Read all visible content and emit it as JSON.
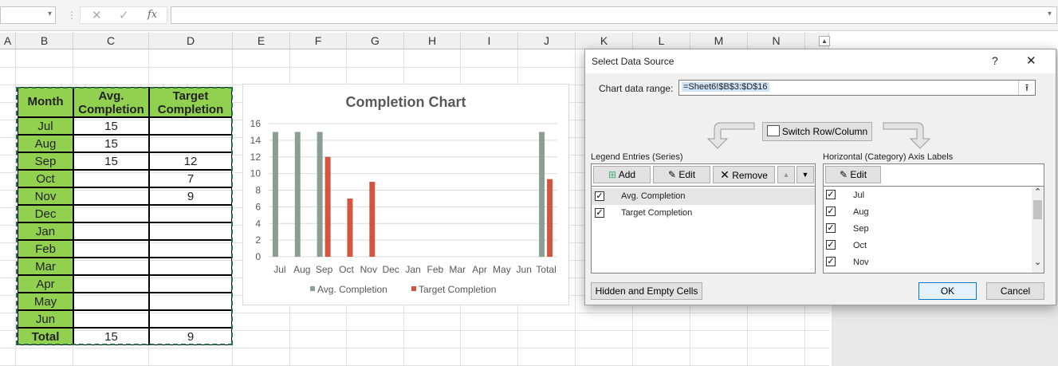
{
  "formula_bar": {
    "fx_label": "fx",
    "cancel_glyph": "✕",
    "enter_glyph": "✓",
    "separator": "⋮",
    "dropdown_glyph": "▾"
  },
  "columns": [
    "A",
    "B",
    "C",
    "D",
    "E",
    "F",
    "G",
    "H",
    "I",
    "J",
    "K",
    "L",
    "M",
    "N"
  ],
  "table": {
    "headers": [
      "Month",
      "Avg.\nCompletion",
      "Target\nCompletion"
    ],
    "rows": [
      [
        "Jul",
        "15",
        ""
      ],
      [
        "Aug",
        "15",
        ""
      ],
      [
        "Sep",
        "15",
        "12"
      ],
      [
        "Oct",
        "",
        "7"
      ],
      [
        "Nov",
        "",
        "9"
      ],
      [
        "Dec",
        "",
        ""
      ],
      [
        "Jan",
        "",
        ""
      ],
      [
        "Feb",
        "",
        ""
      ],
      [
        "Mar",
        "",
        ""
      ],
      [
        "Apr",
        "",
        ""
      ],
      [
        "May",
        "",
        ""
      ],
      [
        "Jun",
        "",
        ""
      ]
    ],
    "total": [
      "Total",
      "15",
      "9"
    ]
  },
  "chart_data": {
    "type": "bar",
    "title": "Completion Chart",
    "categories": [
      "Jul",
      "Aug",
      "Sep",
      "Oct",
      "Nov",
      "Dec",
      "Jan",
      "Feb",
      "Mar",
      "Apr",
      "May",
      "Jun",
      "Total"
    ],
    "series": [
      {
        "name": "Avg. Completion",
        "color": "#8c9d91",
        "values": [
          15,
          15,
          15,
          null,
          null,
          null,
          null,
          null,
          null,
          null,
          null,
          null,
          15
        ]
      },
      {
        "name": "Target Completion",
        "color": "#d4553f",
        "values": [
          null,
          null,
          12,
          7,
          9,
          null,
          null,
          null,
          null,
          null,
          null,
          null,
          9.33
        ]
      }
    ],
    "ylim": [
      0,
      16
    ],
    "yticks": [
      0,
      2,
      4,
      6,
      8,
      10,
      12,
      14,
      16
    ],
    "grid": true,
    "legend": "bottom"
  },
  "dialog": {
    "title": "Select Data Source",
    "help": "?",
    "close": "✕",
    "range_label": "Chart data range:",
    "range_value": "=Sheet6!$B$3:$D$16",
    "collapse_glyph": "⭱",
    "switch_label": "Switch Row/Column",
    "legend_label": "Legend Entries (Series)",
    "add_label": "Add",
    "edit_label": "Edit",
    "remove_label": "Remove",
    "up_glyph": "▲",
    "down_glyph": "▼",
    "series": [
      "Avg. Completion",
      "Target Completion"
    ],
    "axis_label": "Horizontal (Category) Axis Labels",
    "axis_edit_label": "Edit",
    "axis_items": [
      "Jul",
      "Aug",
      "Sep",
      "Oct",
      "Nov"
    ],
    "check_glyph": "✓",
    "scroll_up": "⌃",
    "scroll_down": "⌄",
    "hidden_cells_label": "Hidden and Empty Cells",
    "ok_label": "OK",
    "cancel_label": "Cancel"
  },
  "colors": {
    "header_green": "#92d050",
    "marquee": "#217346",
    "avg_series": "#8c9d91",
    "target_series": "#d4553f"
  }
}
